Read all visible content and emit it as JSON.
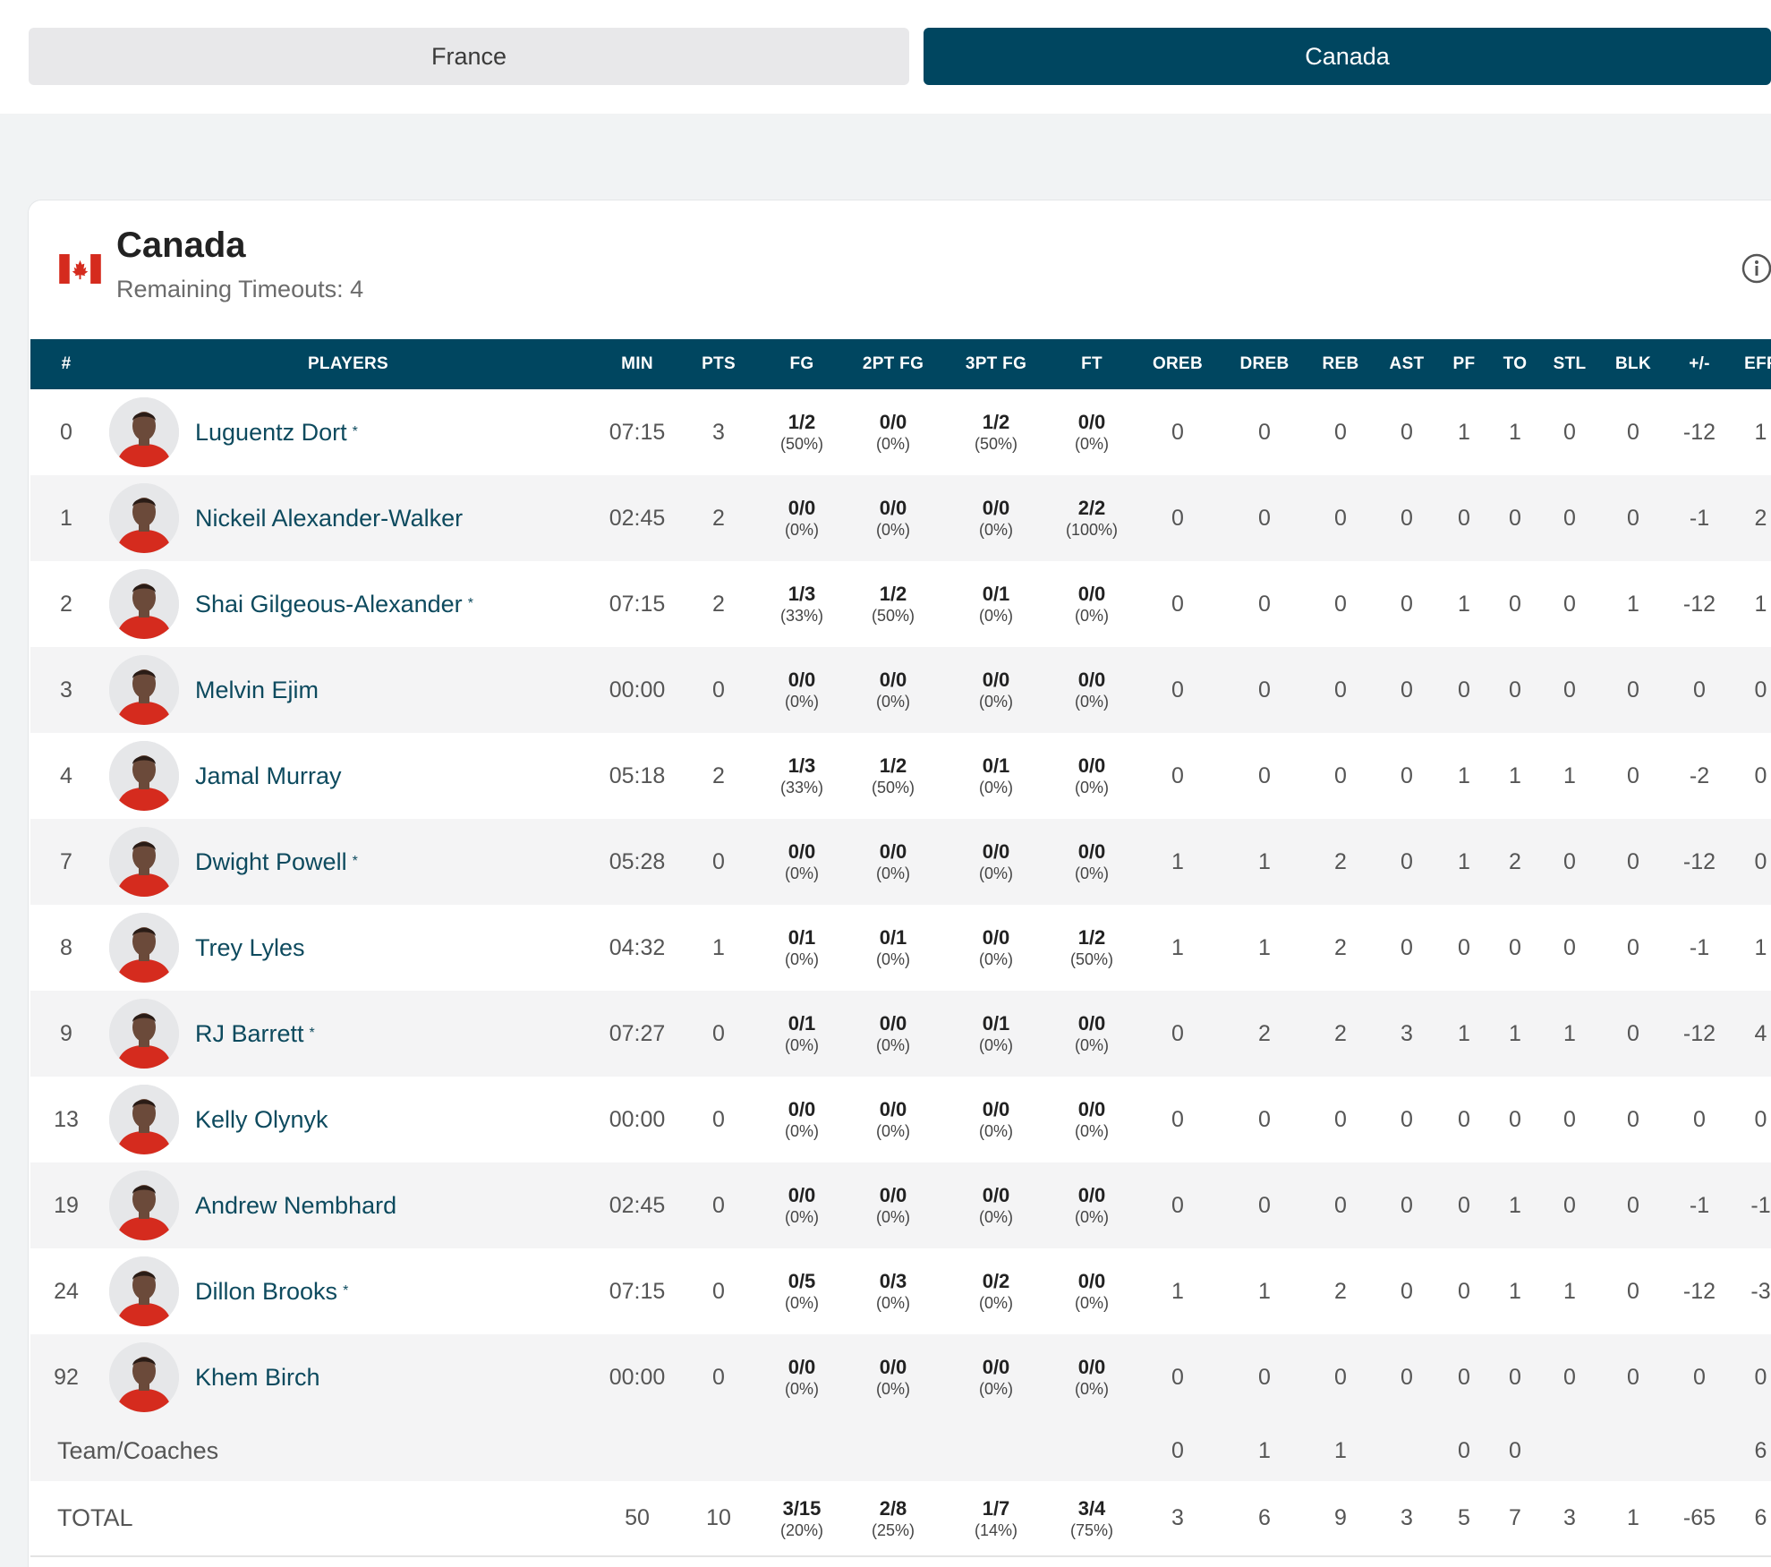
{
  "tabs": [
    {
      "label": "France",
      "active": false
    },
    {
      "label": "Canada",
      "active": true
    }
  ],
  "colors": {
    "primary": "#004660",
    "link": "#0d4a5e",
    "flag_red": "#d52b1e"
  },
  "team": {
    "name": "Canada",
    "timeouts_label": "Remaining Timeouts: 4",
    "flag_icon": "canada-flag-icon",
    "info_icon": "info-icon"
  },
  "columns": [
    "#",
    "PLAYERS",
    "MIN",
    "PTS",
    "FG",
    "2PT FG",
    "3PT FG",
    "FT",
    "OREB",
    "DREB",
    "REB",
    "AST",
    "PF",
    "TO",
    "STL",
    "BLK",
    "+/-",
    "EFF"
  ],
  "starter_mark": "*",
  "players": [
    {
      "num": "0",
      "name": "Luguentz Dort",
      "starter": true,
      "min": "07:15",
      "pts": "3",
      "fg": "1/2",
      "fg_pct": "(50%)",
      "fg2": "0/0",
      "fg2_pct": "(0%)",
      "fg3": "1/2",
      "fg3_pct": "(50%)",
      "ft": "0/0",
      "ft_pct": "(0%)",
      "oreb": "0",
      "dreb": "0",
      "reb": "0",
      "ast": "0",
      "pf": "1",
      "to": "1",
      "stl": "0",
      "blk": "0",
      "pm": "-12",
      "eff": "1"
    },
    {
      "num": "1",
      "name": "Nickeil Alexander-Walker",
      "starter": false,
      "min": "02:45",
      "pts": "2",
      "fg": "0/0",
      "fg_pct": "(0%)",
      "fg2": "0/0",
      "fg2_pct": "(0%)",
      "fg3": "0/0",
      "fg3_pct": "(0%)",
      "ft": "2/2",
      "ft_pct": "(100%)",
      "oreb": "0",
      "dreb": "0",
      "reb": "0",
      "ast": "0",
      "pf": "0",
      "to": "0",
      "stl": "0",
      "blk": "0",
      "pm": "-1",
      "eff": "2"
    },
    {
      "num": "2",
      "name": "Shai Gilgeous-Alexander",
      "starter": true,
      "min": "07:15",
      "pts": "2",
      "fg": "1/3",
      "fg_pct": "(33%)",
      "fg2": "1/2",
      "fg2_pct": "(50%)",
      "fg3": "0/1",
      "fg3_pct": "(0%)",
      "ft": "0/0",
      "ft_pct": "(0%)",
      "oreb": "0",
      "dreb": "0",
      "reb": "0",
      "ast": "0",
      "pf": "1",
      "to": "0",
      "stl": "0",
      "blk": "1",
      "pm": "-12",
      "eff": "1"
    },
    {
      "num": "3",
      "name": "Melvin Ejim",
      "starter": false,
      "min": "00:00",
      "pts": "0",
      "fg": "0/0",
      "fg_pct": "(0%)",
      "fg2": "0/0",
      "fg2_pct": "(0%)",
      "fg3": "0/0",
      "fg3_pct": "(0%)",
      "ft": "0/0",
      "ft_pct": "(0%)",
      "oreb": "0",
      "dreb": "0",
      "reb": "0",
      "ast": "0",
      "pf": "0",
      "to": "0",
      "stl": "0",
      "blk": "0",
      "pm": "0",
      "eff": "0"
    },
    {
      "num": "4",
      "name": "Jamal Murray",
      "starter": false,
      "min": "05:18",
      "pts": "2",
      "fg": "1/3",
      "fg_pct": "(33%)",
      "fg2": "1/2",
      "fg2_pct": "(50%)",
      "fg3": "0/1",
      "fg3_pct": "(0%)",
      "ft": "0/0",
      "ft_pct": "(0%)",
      "oreb": "0",
      "dreb": "0",
      "reb": "0",
      "ast": "0",
      "pf": "1",
      "to": "1",
      "stl": "1",
      "blk": "0",
      "pm": "-2",
      "eff": "0"
    },
    {
      "num": "7",
      "name": "Dwight Powell",
      "starter": true,
      "min": "05:28",
      "pts": "0",
      "fg": "0/0",
      "fg_pct": "(0%)",
      "fg2": "0/0",
      "fg2_pct": "(0%)",
      "fg3": "0/0",
      "fg3_pct": "(0%)",
      "ft": "0/0",
      "ft_pct": "(0%)",
      "oreb": "1",
      "dreb": "1",
      "reb": "2",
      "ast": "0",
      "pf": "1",
      "to": "2",
      "stl": "0",
      "blk": "0",
      "pm": "-12",
      "eff": "0"
    },
    {
      "num": "8",
      "name": "Trey Lyles",
      "starter": false,
      "min": "04:32",
      "pts": "1",
      "fg": "0/1",
      "fg_pct": "(0%)",
      "fg2": "0/1",
      "fg2_pct": "(0%)",
      "fg3": "0/0",
      "fg3_pct": "(0%)",
      "ft": "1/2",
      "ft_pct": "(50%)",
      "oreb": "1",
      "dreb": "1",
      "reb": "2",
      "ast": "0",
      "pf": "0",
      "to": "0",
      "stl": "0",
      "blk": "0",
      "pm": "-1",
      "eff": "1"
    },
    {
      "num": "9",
      "name": "RJ Barrett",
      "starter": true,
      "min": "07:27",
      "pts": "0",
      "fg": "0/1",
      "fg_pct": "(0%)",
      "fg2": "0/0",
      "fg2_pct": "(0%)",
      "fg3": "0/1",
      "fg3_pct": "(0%)",
      "ft": "0/0",
      "ft_pct": "(0%)",
      "oreb": "0",
      "dreb": "2",
      "reb": "2",
      "ast": "3",
      "pf": "1",
      "to": "1",
      "stl": "1",
      "blk": "0",
      "pm": "-12",
      "eff": "4"
    },
    {
      "num": "13",
      "name": "Kelly Olynyk",
      "starter": false,
      "min": "00:00",
      "pts": "0",
      "fg": "0/0",
      "fg_pct": "(0%)",
      "fg2": "0/0",
      "fg2_pct": "(0%)",
      "fg3": "0/0",
      "fg3_pct": "(0%)",
      "ft": "0/0",
      "ft_pct": "(0%)",
      "oreb": "0",
      "dreb": "0",
      "reb": "0",
      "ast": "0",
      "pf": "0",
      "to": "0",
      "stl": "0",
      "blk": "0",
      "pm": "0",
      "eff": "0"
    },
    {
      "num": "19",
      "name": "Andrew Nembhard",
      "starter": false,
      "min": "02:45",
      "pts": "0",
      "fg": "0/0",
      "fg_pct": "(0%)",
      "fg2": "0/0",
      "fg2_pct": "(0%)",
      "fg3": "0/0",
      "fg3_pct": "(0%)",
      "ft": "0/0",
      "ft_pct": "(0%)",
      "oreb": "0",
      "dreb": "0",
      "reb": "0",
      "ast": "0",
      "pf": "0",
      "to": "1",
      "stl": "0",
      "blk": "0",
      "pm": "-1",
      "eff": "-1"
    },
    {
      "num": "24",
      "name": "Dillon Brooks",
      "starter": true,
      "min": "07:15",
      "pts": "0",
      "fg": "0/5",
      "fg_pct": "(0%)",
      "fg2": "0/3",
      "fg2_pct": "(0%)",
      "fg3": "0/2",
      "fg3_pct": "(0%)",
      "ft": "0/0",
      "ft_pct": "(0%)",
      "oreb": "1",
      "dreb": "1",
      "reb": "2",
      "ast": "0",
      "pf": "0",
      "to": "1",
      "stl": "1",
      "blk": "0",
      "pm": "-12",
      "eff": "-3"
    },
    {
      "num": "92",
      "name": "Khem Birch",
      "starter": false,
      "min": "00:00",
      "pts": "0",
      "fg": "0/0",
      "fg_pct": "(0%)",
      "fg2": "0/0",
      "fg2_pct": "(0%)",
      "fg3": "0/0",
      "fg3_pct": "(0%)",
      "ft": "0/0",
      "ft_pct": "(0%)",
      "oreb": "0",
      "dreb": "0",
      "reb": "0",
      "ast": "0",
      "pf": "0",
      "to": "0",
      "stl": "0",
      "blk": "0",
      "pm": "0",
      "eff": "0"
    }
  ],
  "team_coaches": {
    "label": "Team/Coaches",
    "oreb": "0",
    "dreb": "1",
    "reb": "1",
    "pf": "0",
    "to": "0",
    "eff": "6"
  },
  "total": {
    "label": "TOTAL",
    "min": "50",
    "pts": "10",
    "fg": "3/15",
    "fg_pct": "(20%)",
    "fg2": "2/8",
    "fg2_pct": "(25%)",
    "fg3": "1/7",
    "fg3_pct": "(14%)",
    "ft": "3/4",
    "ft_pct": "(75%)",
    "oreb": "3",
    "dreb": "6",
    "reb": "9",
    "ast": "3",
    "pf": "5",
    "to": "7",
    "stl": "3",
    "blk": "1",
    "pm": "-65",
    "eff": "6"
  }
}
